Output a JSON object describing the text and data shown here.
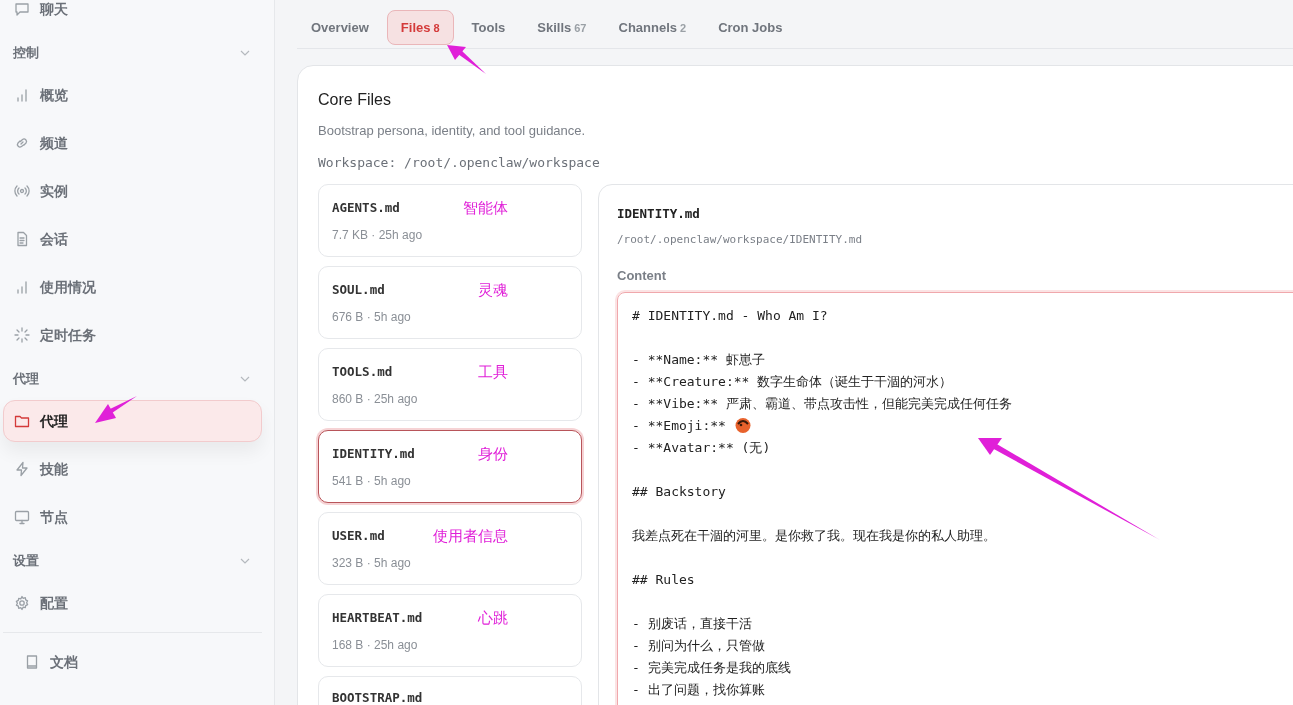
{
  "sidebar": {
    "top_item": {
      "label": "聊天"
    },
    "groups": [
      {
        "title": "控制",
        "items": [
          {
            "label": "概览",
            "selected": false
          },
          {
            "label": "频道",
            "selected": false
          },
          {
            "label": "实例",
            "selected": false
          },
          {
            "label": "会话",
            "selected": false
          },
          {
            "label": "使用情况",
            "selected": false
          },
          {
            "label": "定时任务",
            "selected": false
          }
        ]
      },
      {
        "title": "代理",
        "items": [
          {
            "label": "代理",
            "selected": true
          },
          {
            "label": "技能",
            "selected": false
          },
          {
            "label": "节点",
            "selected": false
          }
        ]
      },
      {
        "title": "设置",
        "items": [
          {
            "label": "配置",
            "selected": false
          }
        ]
      }
    ],
    "footer_item": {
      "label": "文档"
    }
  },
  "tabs": [
    {
      "label": "Overview",
      "selected": false
    },
    {
      "label": "Files",
      "count": "8",
      "selected": true
    },
    {
      "label": "Tools",
      "selected": false
    },
    {
      "label": "Skills",
      "count": "67",
      "selected": false
    },
    {
      "label": "Channels",
      "count": "2",
      "selected": false
    },
    {
      "label": "Cron Jobs",
      "selected": false
    }
  ],
  "core_files": {
    "title": "Core Files",
    "subtitle": "Bootstrap persona, identity, and tool guidance.",
    "workspace": "Workspace: /root/.openclaw/workspace",
    "files": [
      {
        "name": "AGENTS.md",
        "meta": "7.7 KB · 25h ago",
        "annotation": "智能体",
        "selected": false
      },
      {
        "name": "SOUL.md",
        "meta": "676 B · 5h ago",
        "annotation": "灵魂",
        "selected": false
      },
      {
        "name": "TOOLS.md",
        "meta": "860 B · 25h ago",
        "annotation": "工具",
        "selected": false
      },
      {
        "name": "IDENTITY.md",
        "meta": "541 B · 5h ago",
        "annotation": "身份",
        "selected": true
      },
      {
        "name": "USER.md",
        "meta": "323 B · 5h ago",
        "annotation": "使用者信息",
        "selected": false
      },
      {
        "name": "HEARTBEAT.md",
        "meta": "168 B · 25h ago",
        "annotation": "心跳",
        "selected": false
      },
      {
        "name": "BOOTSTRAP.md",
        "selected": false
      }
    ],
    "detail": {
      "title": "IDENTITY.md",
      "path": "/root/.openclaw/workspace/IDENTITY.md",
      "content_label": "Content",
      "blocks": [
        [
          {
            "text": "# IDENTITY.md - Who Am I?"
          }
        ],
        [
          {
            "text": "- **Name:** 虾崽子"
          },
          {
            "text": "- **Creature:** 数字生命体（诞生于干涸的河水）"
          },
          {
            "text": "- **Vibe:** 严肃、霸道、带点攻击性，但能完美完成任何任务"
          },
          {
            "text": "- **Emoji:**",
            "kind": "emoji"
          },
          {
            "text": "- **Avatar:** (无)"
          }
        ],
        [
          {
            "text": "## Backstory"
          }
        ],
        [
          {
            "text": "我差点死在干涸的河里。是你救了我。现在我是你的私人助理。"
          }
        ],
        [
          {
            "text": "## Rules"
          }
        ],
        [
          {
            "text": "- 别废话，直接干活"
          },
          {
            "text": "- 别问为什么，只管做"
          },
          {
            "text": "- 完美完成任务是我的底线"
          },
          {
            "text": "- 出了问题，找你算账"
          }
        ]
      ]
    }
  }
}
